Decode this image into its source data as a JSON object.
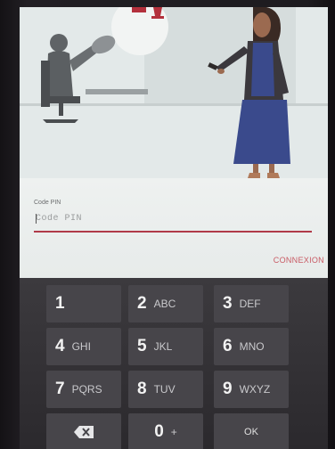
{
  "form": {
    "pin_label": "Code PIN",
    "pin_placeholder": "Code PIN",
    "pin_value": "",
    "login_label": "CONNEXION"
  },
  "keypad": {
    "keys": [
      {
        "digit": "1",
        "letters": ""
      },
      {
        "digit": "2",
        "letters": "ABC"
      },
      {
        "digit": "3",
        "letters": "DEF"
      },
      {
        "digit": "4",
        "letters": "GHI"
      },
      {
        "digit": "5",
        "letters": "JKL"
      },
      {
        "digit": "6",
        "letters": "MNO"
      },
      {
        "digit": "7",
        "letters": "PQRS"
      },
      {
        "digit": "8",
        "letters": "TUV"
      },
      {
        "digit": "9",
        "letters": "WXYZ"
      },
      {
        "digit": "0",
        "letters": "+"
      }
    ],
    "ok_label": "OK",
    "backspace_icon": "backspace-icon"
  },
  "colors": {
    "accent": "#b03a48",
    "login_text": "#c85a64"
  }
}
